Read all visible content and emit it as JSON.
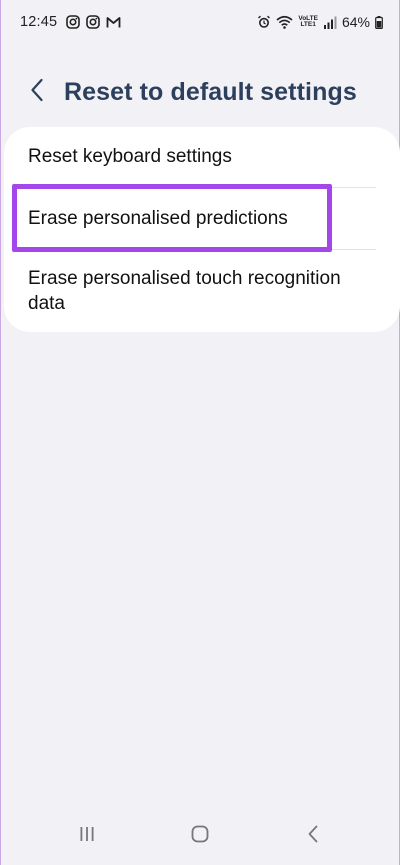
{
  "status_bar": {
    "time": "12:45",
    "battery_percent": "64%",
    "network_label_top": "VoLTE",
    "network_label_bottom": "LTE1",
    "left_icons": [
      "instagram-icon",
      "instagram-icon",
      "gmail-icon"
    ],
    "right_icons": [
      "alarm-icon",
      "wifi-icon",
      "signal-icon",
      "battery-icon"
    ]
  },
  "header": {
    "back_icon": "chevron-left-icon",
    "title": "Reset to default settings"
  },
  "settings": {
    "items": [
      {
        "label": "Reset keyboard settings"
      },
      {
        "label": "Erase personalised predictions"
      },
      {
        "label": "Erase personalised touch recognition data"
      }
    ]
  },
  "highlight_color": "#a347ea",
  "nav_bar": {
    "icons": [
      "recent-apps-icon",
      "home-icon",
      "back-icon"
    ]
  }
}
